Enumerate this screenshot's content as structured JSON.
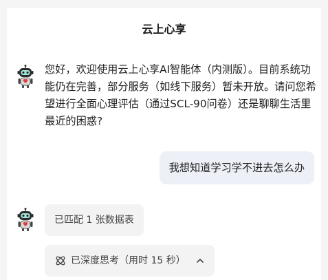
{
  "header": {
    "title": "云上心享"
  },
  "messages": {
    "bot_greeting": "您好，欢迎使用云上心享AI智能体（内测版）。目前系统功能仍在完善，部分服务（如线下服务）暂未开放。请问您希望进行全面心理评估（通过SCL-90问卷）还是聊聊生活里最近的困惑?",
    "user_question": "我想知道学习学不进去怎么办",
    "match_status": "已匹配 1 张数据表",
    "thinking_status": "已深度思考（用时 15 秒）"
  },
  "icons": {
    "bot_avatar": "robot-icon",
    "thinking": "atom-icon",
    "collapse": "chevron-up-icon"
  },
  "colors": {
    "user_bubble": "#eef0f8",
    "status_pill": "#f3f3f3",
    "robot_heart": "#e03c3c"
  }
}
